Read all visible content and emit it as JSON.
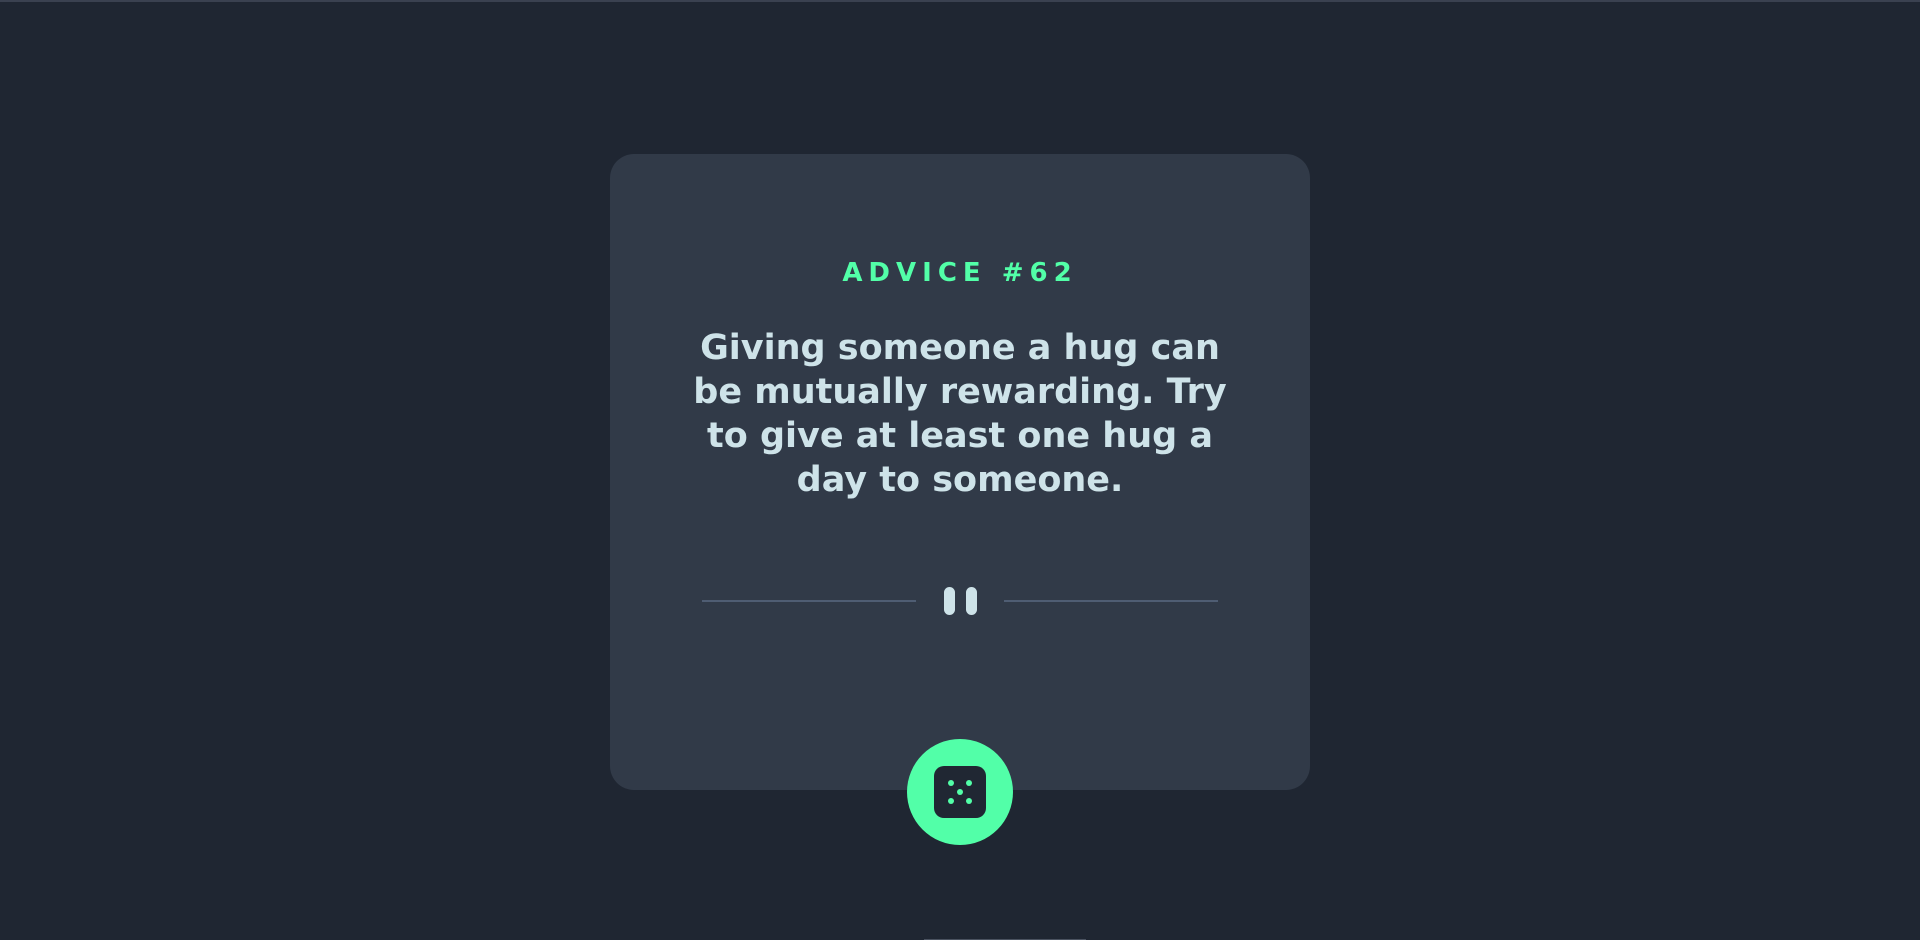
{
  "advice": {
    "id_label": "ADVICE #62",
    "text": "Giving someone a hug can be mutually rewarding. Try to give at least one hug a day to someone."
  },
  "divider": {
    "icon": "pause-icon"
  },
  "generate_button": {
    "icon": "dice-icon"
  },
  "colors": {
    "background": "#1f2632",
    "card": "#313a48",
    "accent": "#52ffa8",
    "text": "#cee3e9",
    "divider_line": "#4f5d73"
  }
}
